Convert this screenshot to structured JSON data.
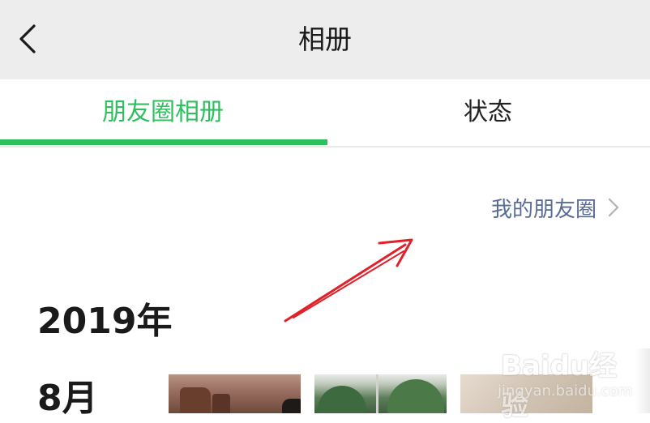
{
  "header": {
    "title": "相册",
    "back_icon": "chevron-left-icon"
  },
  "tabs": [
    {
      "label": "朋友圈相册",
      "active": true
    },
    {
      "label": "状态",
      "active": false
    }
  ],
  "colors": {
    "accent": "#2ebf5f",
    "link": "#576b95",
    "header_bg": "#ededed"
  },
  "moments_link": {
    "label": "我的朋友圈",
    "icon": "chevron-right-icon"
  },
  "timeline": {
    "year": "2019年",
    "month": "8月"
  },
  "watermark": {
    "logo": "Baidu经验",
    "sub": "jingyan.baidu.com"
  }
}
